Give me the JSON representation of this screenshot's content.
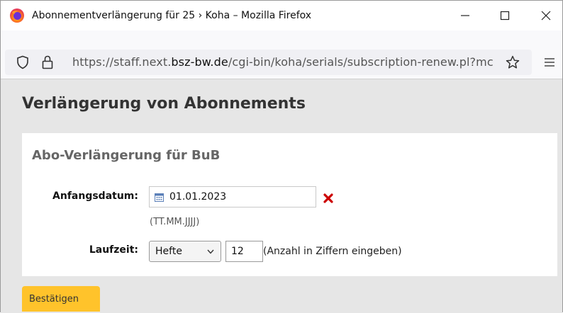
{
  "window": {
    "title": "Abonnementverlängerung für 25 › Koha – Mozilla Firefox"
  },
  "browser": {
    "url_prefix": "https://staff.next.",
    "url_domain": "bsz-bw.de",
    "url_suffix": "/cgi-bin/koha/serials/subscription-renew.pl?mc"
  },
  "page": {
    "title": "Verlängerung von Abonnements",
    "panel_title": "Abo-Verlängerung für BuB"
  },
  "form": {
    "start_date_label": "Anfangsdatum:",
    "start_date_value": "01.01.2023",
    "date_format_hint": "(TT.MM.JJJJ)",
    "duration_label": "Laufzeit:",
    "duration_unit": "Hefte",
    "duration_value": "12",
    "duration_hint": "(Anzahl in Ziffern eingeben)",
    "submit_label": "Bestätigen"
  },
  "colors": {
    "submit_bg": "#ffc32b",
    "clear_icon": "#cc0000",
    "page_bg": "#e6e6e6"
  },
  "icons": [
    "firefox-logo-icon",
    "minimize-icon",
    "maximize-icon",
    "close-icon",
    "shield-icon",
    "lock-icon",
    "bookmark-star-icon",
    "menu-icon",
    "calendar-icon",
    "clear-date-icon",
    "chevron-down-icon"
  ]
}
